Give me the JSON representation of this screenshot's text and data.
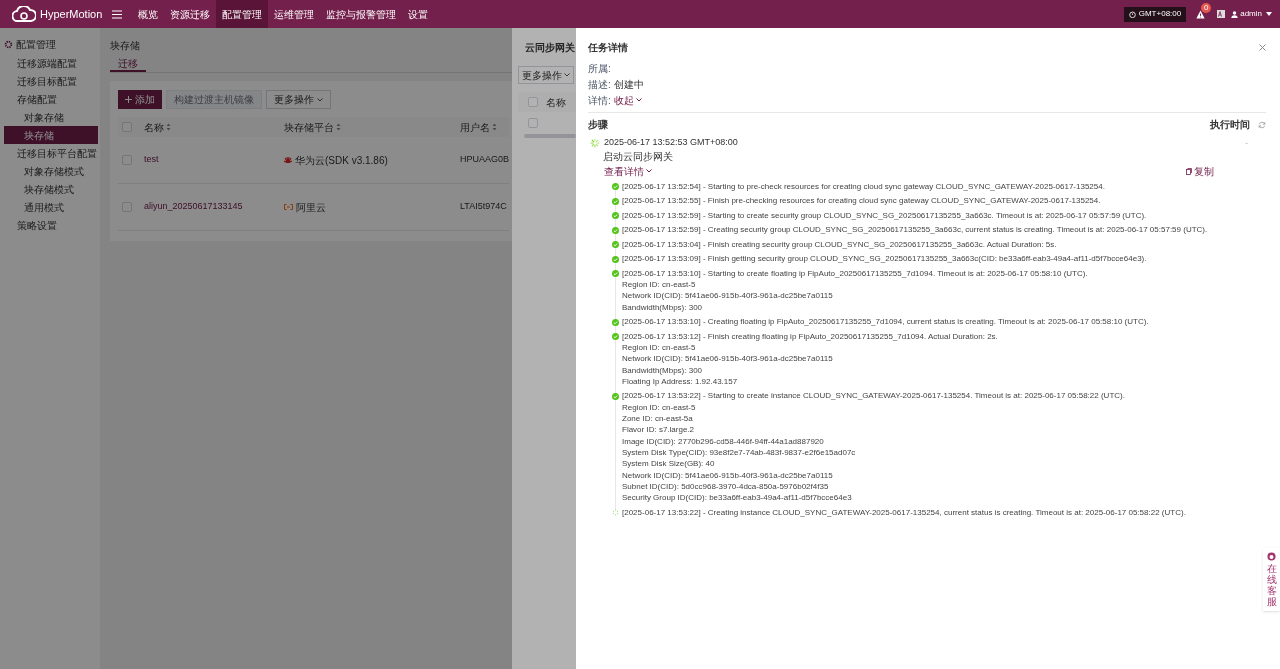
{
  "header": {
    "logo_text": "HyperMotion",
    "nav": [
      {
        "label": "概览",
        "selected": false
      },
      {
        "label": "资源迁移",
        "selected": false
      },
      {
        "label": "配置管理",
        "selected": true
      },
      {
        "label": "运维管理",
        "selected": false
      },
      {
        "label": "监控与报警管理",
        "selected": false
      },
      {
        "label": "设置",
        "selected": false
      }
    ],
    "timezone": "GMT+08:00",
    "alert_count": "0",
    "user": "admin"
  },
  "sidebar": {
    "title": "配置管理",
    "items": [
      {
        "label": "迁移源端配置",
        "selected": false
      },
      {
        "label": "迁移目标配置",
        "selected": false
      },
      {
        "label": "存储配置",
        "selected": false,
        "children": [
          {
            "label": "对象存储",
            "selected": false
          },
          {
            "label": "块存储",
            "selected": true
          }
        ]
      },
      {
        "label": "迁移目标平台配置",
        "selected": false,
        "children": [
          {
            "label": "对象存储模式",
            "selected": false
          },
          {
            "label": "块存储模式",
            "selected": false
          },
          {
            "label": "通用模式",
            "selected": false
          }
        ]
      },
      {
        "label": "策略设置",
        "selected": false
      }
    ]
  },
  "page": {
    "title": "块存储",
    "tabs": [
      {
        "label": "迁移",
        "selected": true
      }
    ],
    "toolbar": [
      {
        "label": "添加",
        "kind": "primary"
      },
      {
        "label": "构建过渡主机镜像",
        "kind": "disabled"
      },
      {
        "label": "更多操作",
        "kind": "dropdown"
      }
    ],
    "all_checked": false,
    "columns": [
      "名称",
      "块存储平台",
      "用户名"
    ],
    "rows": [
      {
        "checked": false,
        "name": "test",
        "platform": "华为云(SDK v3.1.86)",
        "kind": "huawei",
        "username": "HPUAAG0B"
      },
      {
        "checked": false,
        "name": "aliyun_20250617133145",
        "platform": "阿里云",
        "kind": "aliyun",
        "username": "LTAI5t974C"
      }
    ]
  },
  "drawer": {
    "title": "云同步网关",
    "more": "更多操作",
    "all_checked": false,
    "columns": [
      "名称"
    ],
    "rows": [
      {
        "checked": false
      }
    ]
  },
  "task": {
    "title": "任务详情",
    "fields": [
      {
        "label": "所属:"
      },
      {
        "label": "描述:",
        "value": "创建中",
        "kind": "text"
      },
      {
        "label": "详情:",
        "value": "收起",
        "kind": "toggle"
      }
    ],
    "steps_label": "步骤",
    "exec_time": "执行时间",
    "step": {
      "time": "2025-06-17 13:52:53 GMT+08:00",
      "loading": true,
      "tail": "-",
      "name": "启动云同步网关",
      "details_link": "查看详情",
      "copy": "复制",
      "logs": [
        {
          "done": true,
          "text": "[2025-06-17 13:52:54] - Starting to pre-check resources for creating cloud sync gateway CLOUD_SYNC_GATEWAY-2025-0617-135254."
        },
        {
          "done": true,
          "text": "[2025-06-17 13:52:55] - Finish pre-checking resources for creating cloud sync gateway CLOUD_SYNC_GATEWAY-2025-0617-135254."
        },
        {
          "done": true,
          "text": "[2025-06-17 13:52:59] - Starting to create security group CLOUD_SYNC_SG_20250617135255_3a663c. Timeout is at: 2025-06-17 05:57:59 (UTC)."
        },
        {
          "done": true,
          "text": "[2025-06-17 13:52:59] - Creating security group CLOUD_SYNC_SG_20250617135255_3a663c, current status is creating. Timeout is at: 2025-06-17 05:57:59 (UTC)."
        },
        {
          "done": true,
          "text": "[2025-06-17 13:53:04] - Finish creating security group CLOUD_SYNC_SG_20250617135255_3a663c. Actual Duration: 5s."
        },
        {
          "done": true,
          "text": "[2025-06-17 13:53:09] - Finish getting security group CLOUD_SYNC_SG_20250617135255_3a663c(CID: be33a6ff-eab3-49a4-af11-d5f7bcce64e3)."
        },
        {
          "done": true,
          "text": "[2025-06-17 13:53:10] - Starting to create floating ip FipAuto_20250617135255_7d1094. Timeout is at: 2025-06-17 05:58:10 (UTC).",
          "details": [
            "Region ID: cn-east-5",
            "Network ID(CID): 5f41ae06-915b-40f3-961a-dc25be7a0115",
            "Bandwidth(Mbps): 300"
          ]
        },
        {
          "done": true,
          "text": "[2025-06-17 13:53:10] - Creating floating ip FipAuto_20250617135255_7d1094, current status is creating. Timeout is at: 2025-06-17 05:58:10 (UTC)."
        },
        {
          "done": true,
          "text": "[2025-06-17 13:53:12] - Finish creating floating ip FipAuto_20250617135255_7d1094. Actual Duration: 2s.",
          "details": [
            "Region ID: cn-east-5",
            "Network ID(CID): 5f41ae06-915b-40f3-961a-dc25be7a0115",
            "Bandwidth(Mbps): 300",
            "Floating Ip Address: 1.92.43.157"
          ]
        },
        {
          "done": true,
          "text": "[2025-06-17 13:53:22] - Starting to create instance CLOUD_SYNC_GATEWAY-2025-0617-135254. Timeout is at: 2025-06-17 05:58:22 (UTC).",
          "details": [
            "Region ID: cn-east-5",
            "Zone ID: cn-east-5a",
            "Flavor ID: s7.large.2",
            "Image ID(CID): 2770b296-cd58-446f-94ff-44a1ad887920",
            "System Disk Type(CID): 93e8f2e7-74ab-483f-9837-e2f6e15ad07c",
            "System Disk Size(GB): 40",
            "Network ID(CID): 5f41ae06-915b-40f3-961a-dc25be7a0115",
            "Subnet ID(CID): 5d0cc968-3970-4dca-850a-5976b02f4f35",
            "Security Group ID(CID): be33a6ff-eab3-49a4-af11-d5f7bcce64e3"
          ]
        },
        {
          "done": false,
          "text": "[2025-06-17 13:53:22] - Creating instance CLOUD_SYNC_GATEWAY-2025-0617-135254, current status is creating. Timeout is at: 2025-06-17 05:58:22 (UTC)."
        }
      ]
    }
  },
  "help": {
    "label": "在线客服"
  }
}
